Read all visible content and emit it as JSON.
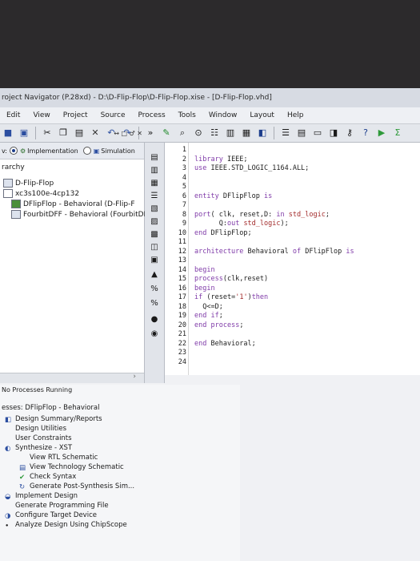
{
  "window": {
    "title": "roject Navigator (P.28xd) - D:\\D-Flip-Flop\\D-Flip-Flop.xise - [D-Flip-Flop.vhd]"
  },
  "menu": [
    "Edit",
    "View",
    "Project",
    "Source",
    "Process",
    "Tools",
    "Window",
    "Layout",
    "Help"
  ],
  "view_panel": {
    "prefix": "v:",
    "implementation_label": "Implementation",
    "simulation_label": "Simulation",
    "hierarchy_label": "rarchy",
    "window_controls": "↔ □ ♂ ✕"
  },
  "hierarchy": [
    {
      "label": "D-Flip-Flop"
    },
    {
      "label": "xc3s100e-4cp132"
    },
    {
      "label": "DFlipFlop - Behavioral (D-Flip-F"
    },
    {
      "label": "FourbitDFF - Behavioral (FourbitDF"
    }
  ],
  "editor": {
    "lines": [
      {
        "n": "1",
        "text": ""
      },
      {
        "n": "2",
        "text": "library IEEE;"
      },
      {
        "n": "3",
        "text": "use IEEE.STD_LOGIC_1164.ALL;"
      },
      {
        "n": "4",
        "text": ""
      },
      {
        "n": "5",
        "text": ""
      },
      {
        "n": "6",
        "text": "entity DFlipFlop is"
      },
      {
        "n": "7",
        "text": ""
      },
      {
        "n": "8",
        "text": "port( clk, reset,D: in std_logic;"
      },
      {
        "n": "9",
        "text": "      Q:out std_logic);"
      },
      {
        "n": "10",
        "text": "end DFlipFlop;"
      },
      {
        "n": "11",
        "text": ""
      },
      {
        "n": "12",
        "text": "architecture Behavioral of DFlipFlop is"
      },
      {
        "n": "13",
        "text": ""
      },
      {
        "n": "14",
        "text": "begin"
      },
      {
        "n": "15",
        "text": "process(clk,reset)"
      },
      {
        "n": "16",
        "text": "begin"
      },
      {
        "n": "17",
        "text": "if (reset='1')then"
      },
      {
        "n": "18",
        "text": "  Q<=D;"
      },
      {
        "n": "19",
        "text": "end if;"
      },
      {
        "n": "20",
        "text": "end process;"
      },
      {
        "n": "21",
        "text": ""
      },
      {
        "n": "22",
        "text": "end Behavioral;"
      },
      {
        "n": "23",
        "text": ""
      },
      {
        "n": "24",
        "text": ""
      }
    ]
  },
  "processes": {
    "status": "No Processes Running",
    "header": "esses: DFlipFlop - Behavioral",
    "items": [
      {
        "label": "Design Summary/Reports"
      },
      {
        "label": "Design Utilities"
      },
      {
        "label": "User Constraints"
      },
      {
        "label": "Synthesize - XST"
      },
      {
        "label": "View RTL Schematic"
      },
      {
        "label": "View Technology Schematic"
      },
      {
        "label": "Check Syntax"
      },
      {
        "label": "Generate Post-Synthesis Sim..."
      },
      {
        "label": "Implement Design"
      },
      {
        "label": "Generate Programming File"
      },
      {
        "label": "Configure Target Device"
      },
      {
        "label": "Analyze Design Using ChipScope"
      }
    ]
  },
  "colors": {
    "keyword": "#7f3aa8",
    "string": "#a32b2b",
    "check_ok": "#2e9a3a"
  }
}
